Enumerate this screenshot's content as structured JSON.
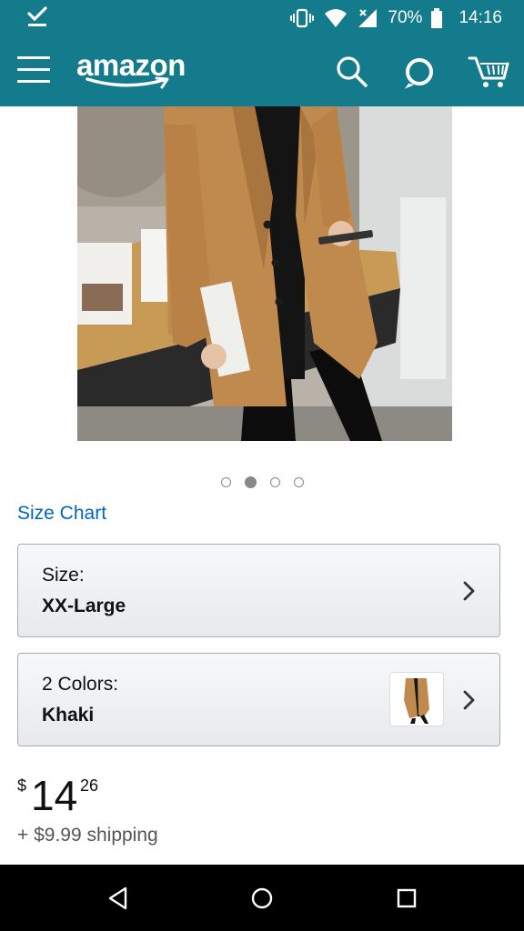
{
  "status_bar": {
    "battery": "70%",
    "time": "14:16"
  },
  "app_bar": {
    "logo": "amazon",
    "icons": [
      "menu-icon",
      "search-icon",
      "alexa-icon",
      "cart-icon"
    ]
  },
  "carousel": {
    "page_count": 4,
    "active_index": 1
  },
  "size_chart_label": "Size Chart",
  "size_selector": {
    "label": "Size:",
    "value": "XX-Large"
  },
  "color_selector": {
    "label": "2 Colors:",
    "value": "Khaki"
  },
  "price": {
    "symbol": "$",
    "whole": "14",
    "fraction": "26"
  },
  "shipping": "+ $9.99 shipping",
  "colors": {
    "brand_teal": "#137b8c",
    "link_blue": "#0066c0",
    "coat_khaki": "#c08a4f"
  }
}
